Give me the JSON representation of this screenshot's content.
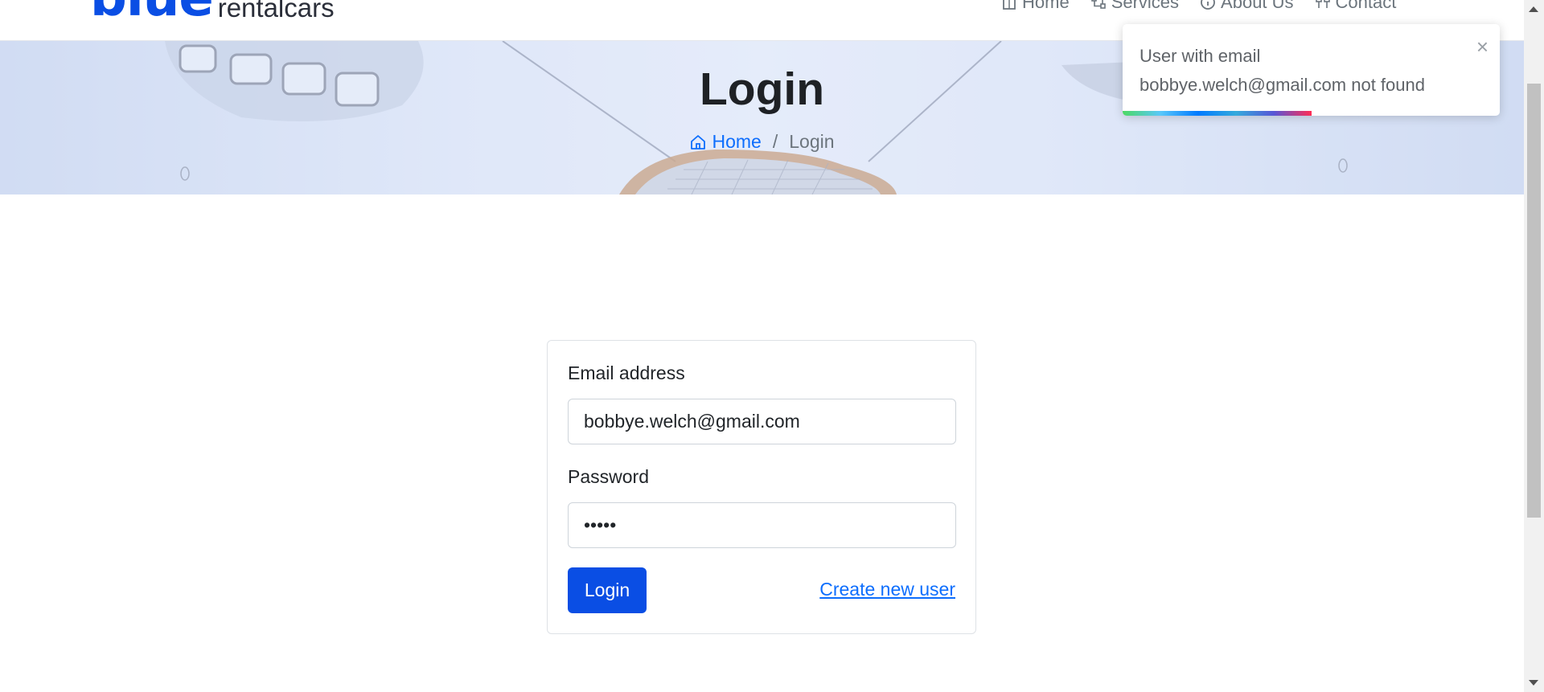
{
  "navbar": {
    "logo_primary": "blue",
    "logo_secondary": "rentalcars",
    "items": [
      {
        "label": "Home",
        "icon": "home-icon"
      },
      {
        "label": "Services",
        "icon": "services-icon"
      },
      {
        "label": "About Us",
        "icon": "info-icon"
      },
      {
        "label": "Contact",
        "icon": "contact-icon"
      }
    ]
  },
  "hero": {
    "title": "Login",
    "breadcrumb": {
      "home": "Home",
      "separator": "/",
      "current": "Login"
    }
  },
  "toast": {
    "message": "User with email bobbye.welch@gmail.com not found",
    "close": "×",
    "progress_percent": 50
  },
  "form": {
    "email_label": "Email address",
    "email_value": "bobbye.welch@gmail.com",
    "password_label": "Password",
    "password_value": "•••••",
    "login_button": "Login",
    "create_user_link": "Create new user"
  },
  "colors": {
    "brand": "#0a4ee4",
    "link": "#0d6efd"
  }
}
